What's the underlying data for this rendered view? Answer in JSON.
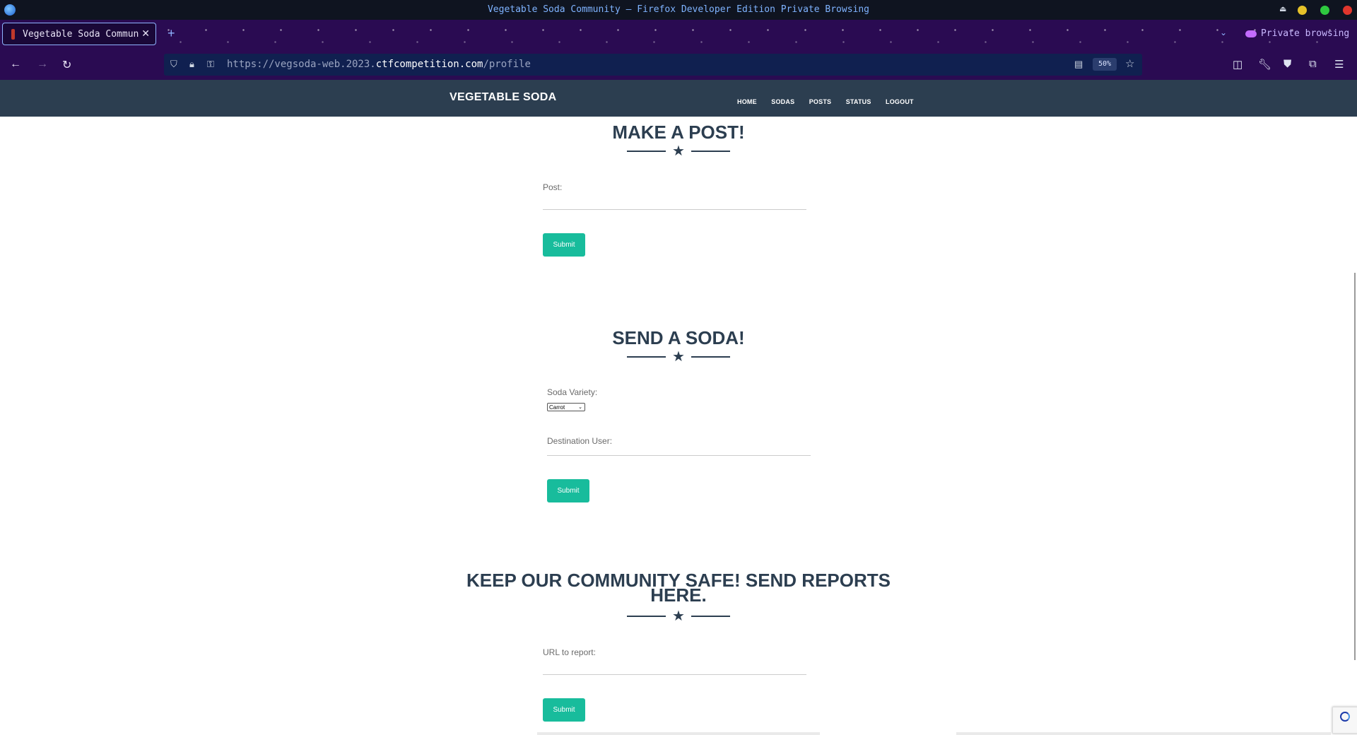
{
  "window": {
    "title": "Vegetable Soda Community — Firefox Developer Edition Private Browsing",
    "controls_colors": {
      "minimize": "#e6c229",
      "maximize": "#2ec93f",
      "close": "#e0362d"
    }
  },
  "tabs": [
    {
      "title": "Vegetable Soda Commun",
      "close_glyph": "✕"
    }
  ],
  "tabbar": {
    "new_tab_glyph": "+",
    "list_all_glyph": "⌄",
    "private_label": "Private browsing"
  },
  "toolbar": {
    "back_glyph": "←",
    "forward_glyph": "→",
    "reload_glyph": "↻",
    "url_prefix": "https://vegsoda-web.2023.",
    "url_domain": "ctfcompetition.com",
    "url_path": "/profile",
    "zoom": "50%"
  },
  "site": {
    "brand": "VEGETABLE SODA",
    "nav": [
      "HOME",
      "SODAS",
      "POSTS",
      "STATUS",
      "LOGOUT"
    ],
    "post_section": {
      "title": "MAKE A POST!",
      "label": "Post:",
      "submit": "Submit"
    },
    "soda_section": {
      "title": "SEND A SODA!",
      "variety_label": "Soda Variety:",
      "variety_selected": "Carrot",
      "destination_label": "Destination User:",
      "submit": "Submit"
    },
    "report_section": {
      "title_line1": "KEEP OUR COMMUNITY SAFE! SEND REPORTS",
      "title_line2": "HERE.",
      "label": "URL to report:",
      "submit": "Submit"
    },
    "divider_glyph": "★"
  },
  "colors": {
    "primary": "#2c3e50",
    "accent": "#18bc9c",
    "private_bg": "#2a0b52"
  }
}
